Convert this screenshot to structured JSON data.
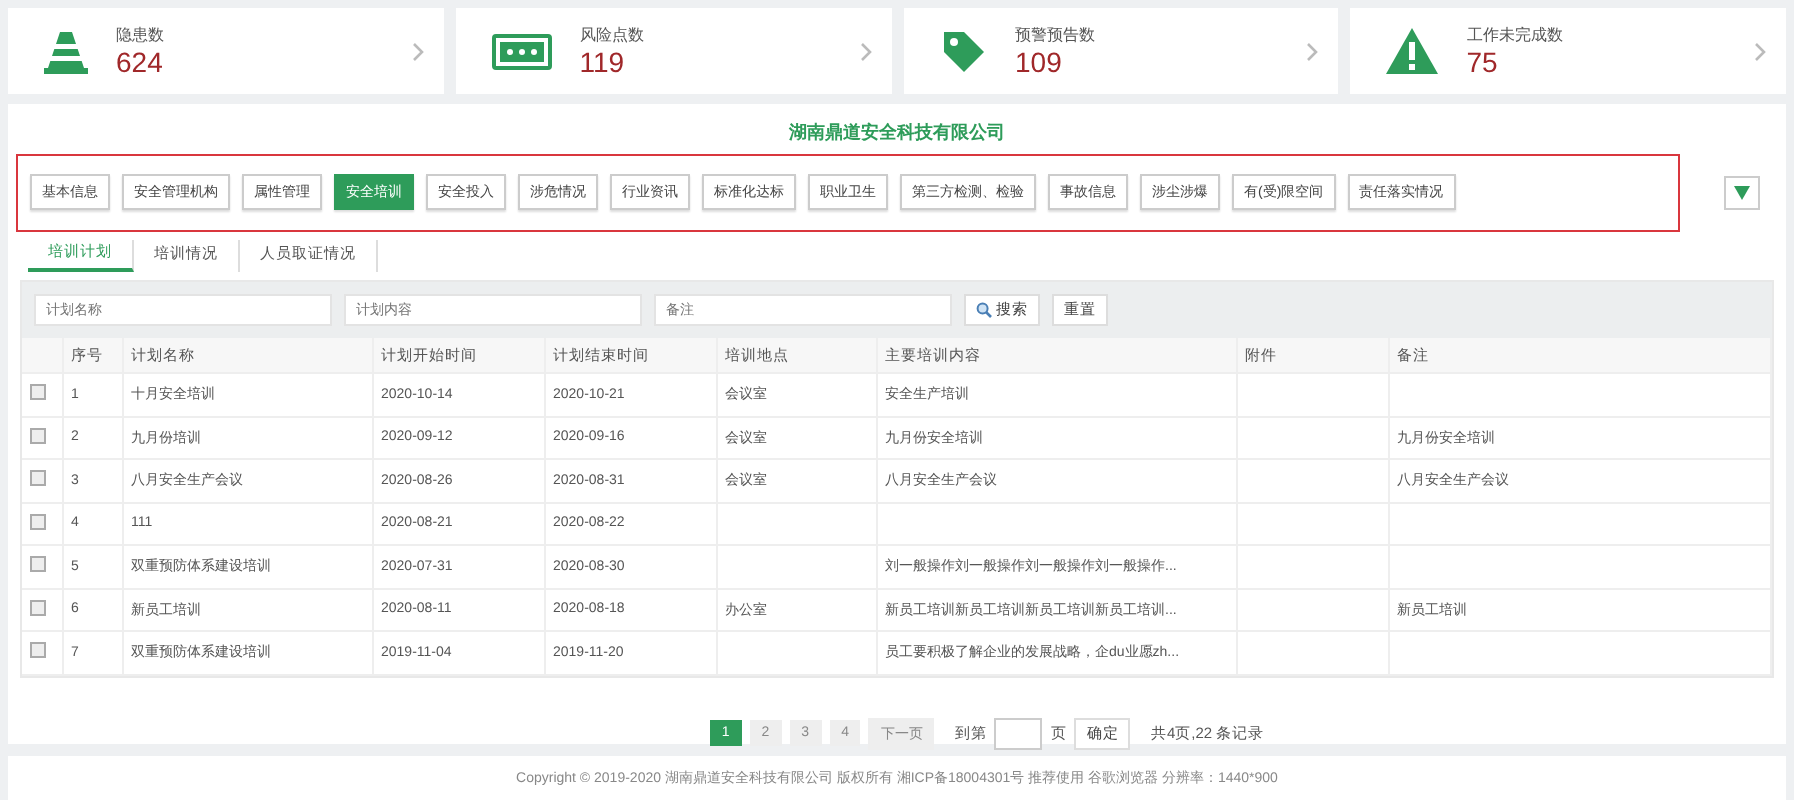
{
  "stats": [
    {
      "kind": "cone",
      "label": "隐患数",
      "value": "624"
    },
    {
      "kind": "ticket",
      "label": "风险点数",
      "value": "119"
    },
    {
      "kind": "tag",
      "label": "预警预告数",
      "value": "109"
    },
    {
      "kind": "warning",
      "label": "工作未完成数",
      "value": "75"
    }
  ],
  "company": "湖南鼎道安全科技有限公司",
  "modules": [
    {
      "label": "基本信息",
      "selected": false
    },
    {
      "label": "安全管理机构",
      "selected": false
    },
    {
      "label": "属性管理",
      "selected": false
    },
    {
      "label": "安全培训",
      "selected": true
    },
    {
      "label": "安全投入",
      "selected": false
    },
    {
      "label": "涉危情况",
      "selected": false
    },
    {
      "label": "行业资讯",
      "selected": false
    },
    {
      "label": "标准化达标",
      "selected": false
    },
    {
      "label": "职业卫生",
      "selected": false
    },
    {
      "label": "第三方检测、检验",
      "selected": false
    },
    {
      "label": "事故信息",
      "selected": false
    },
    {
      "label": "涉尘涉爆",
      "selected": false
    },
    {
      "label": "有(受)限空间",
      "selected": false
    },
    {
      "label": "责任落实情况",
      "selected": false
    }
  ],
  "subtabs": [
    {
      "label": "培训计划",
      "selected": true
    },
    {
      "label": "培训情况",
      "selected": false
    },
    {
      "label": "人员取证情况",
      "selected": false
    }
  ],
  "filters": [
    {
      "placeholder": "计划名称"
    },
    {
      "placeholder": "计划内容"
    },
    {
      "placeholder": "备注"
    }
  ],
  "search_button": "搜索",
  "reset_button": "重置",
  "table": {
    "columns": [
      "序号",
      "计划名称",
      "计划开始时间",
      "计划结束时间",
      "培训地点",
      "主要培训内容",
      "附件",
      "备注"
    ],
    "rows": [
      {
        "checked": false,
        "cells": [
          "1",
          "十月安全培训",
          "2020-10-14",
          "2020-10-21",
          "会议室",
          "安全生产培训",
          "",
          ""
        ]
      },
      {
        "checked": false,
        "cells": [
          "2",
          "九月份培训",
          "2020-09-12",
          "2020-09-16",
          "会议室",
          "九月份安全培训",
          "",
          "九月份安全培训"
        ]
      },
      {
        "checked": false,
        "cells": [
          "3",
          "八月安全生产会议",
          "2020-08-26",
          "2020-08-31",
          "会议室",
          "八月安全生产会议",
          "",
          "八月安全生产会议"
        ]
      },
      {
        "checked": false,
        "cells": [
          "4",
          "111",
          "2020-08-21",
          "2020-08-22",
          "",
          "",
          "",
          ""
        ]
      },
      {
        "checked": false,
        "cells": [
          "5",
          "双重预防体系建设培训",
          "2020-07-31",
          "2020-08-30",
          "",
          "刘一般操作刘一般操作刘一般操作刘一般操作...",
          "",
          ""
        ]
      },
      {
        "checked": false,
        "cells": [
          "6",
          "新员工培训",
          "2020-08-11",
          "2020-08-18",
          "办公室",
          "新员工培训新员工培训新员工培训新员工培训...",
          "",
          "新员工培训"
        ]
      },
      {
        "checked": false,
        "cells": [
          "7",
          "双重预防体系建设培训",
          "2019-11-04",
          "2019-11-20",
          "",
          "员工要积极了解企业的发展战略，企du业愿zh...",
          "",
          ""
        ]
      }
    ]
  },
  "pagination": {
    "pages": [
      {
        "label": "1",
        "selected": true
      },
      {
        "label": "2",
        "selected": false
      },
      {
        "label": "3",
        "selected": false
      },
      {
        "label": "4",
        "selected": false
      }
    ],
    "next": "下一页",
    "goto_prefix": "到第",
    "goto_suffix": "页",
    "confirm": "确定",
    "summary": "共4页,22 条记录"
  },
  "footer": "Copyright © 2019-2020 湖南鼎道安全科技有限公司 版权所有 湘ICP备18004301号 推荐使用 谷歌浏览器 分辨率：1440*900"
}
